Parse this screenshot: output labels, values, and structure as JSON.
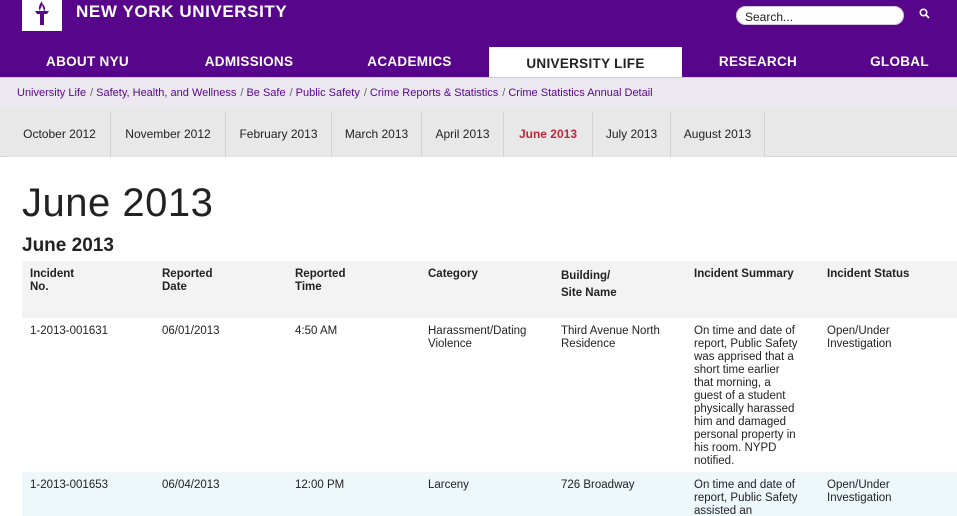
{
  "header": {
    "brand": "NEW YORK UNIVERSITY",
    "search_placeholder": "Search...",
    "icons": {
      "logo": "torch-logo-icon",
      "search": "magnifier-icon"
    }
  },
  "nav": {
    "items": [
      {
        "label": "ABOUT NYU"
      },
      {
        "label": "ADMISSIONS"
      },
      {
        "label": "ACADEMICS"
      },
      {
        "label": "UNIVERSITY LIFE"
      },
      {
        "label": "RESEARCH"
      },
      {
        "label": "GLOBAL"
      }
    ],
    "active_index": 3
  },
  "breadcrumb": [
    "University Life",
    "Safety, Health, and Wellness",
    "Be Safe",
    "Public Safety",
    "Crime Reports & Statistics",
    "Crime Statistics Annual Detail"
  ],
  "months": {
    "items": [
      "October 2012",
      "November 2012",
      "February 2013",
      "March 2013",
      "April 2013",
      "June 2013",
      "July 2013",
      "August 2013"
    ],
    "active_index": 5
  },
  "page": {
    "title": "June 2013",
    "section_title": "June 2013"
  },
  "table": {
    "headers": {
      "incident_no_1": "Incident",
      "incident_no_2": "No.",
      "date_1": "Reported",
      "date_2": "Date",
      "time_1": "Reported",
      "time_2": "Time",
      "category": "Category",
      "building_1": "Building/",
      "building_2": "Site Name",
      "summary": "Incident Summary",
      "status": "Incident Status"
    },
    "rows": [
      {
        "incident_no": "1-2013-001631",
        "date": "06/01/2013",
        "time": "4:50 AM",
        "category_1": "Harassment/Dating",
        "category_2": "Violence",
        "building_1": "Third Avenue North",
        "building_2": "Residence",
        "summary": [
          "On time and date of",
          "report, Public Safety",
          "was apprised that a",
          "short time earlier",
          "that morning, a",
          "guest of a student",
          "physically harassed",
          "him and damaged",
          "personal property in",
          "his room. NYPD",
          "notified."
        ],
        "status_1": "Open/Under",
        "status_2": "Investigation"
      },
      {
        "incident_no": "1-2013-001653",
        "date": "06/04/2013",
        "time": "12:00 PM",
        "category_1": "Larceny",
        "building_1": "726 Broadway",
        "summary": [
          "On time and date of",
          "report, Public Safety",
          "assisted an"
        ],
        "status_1": "Open/Under",
        "status_2": "Investigation"
      }
    ]
  },
  "colors": {
    "brand_purple": "#57068c",
    "active_month": "#c0283e",
    "breadcrumb_bg": "#ebe8ef",
    "tab_bg": "#e8e8e8"
  }
}
